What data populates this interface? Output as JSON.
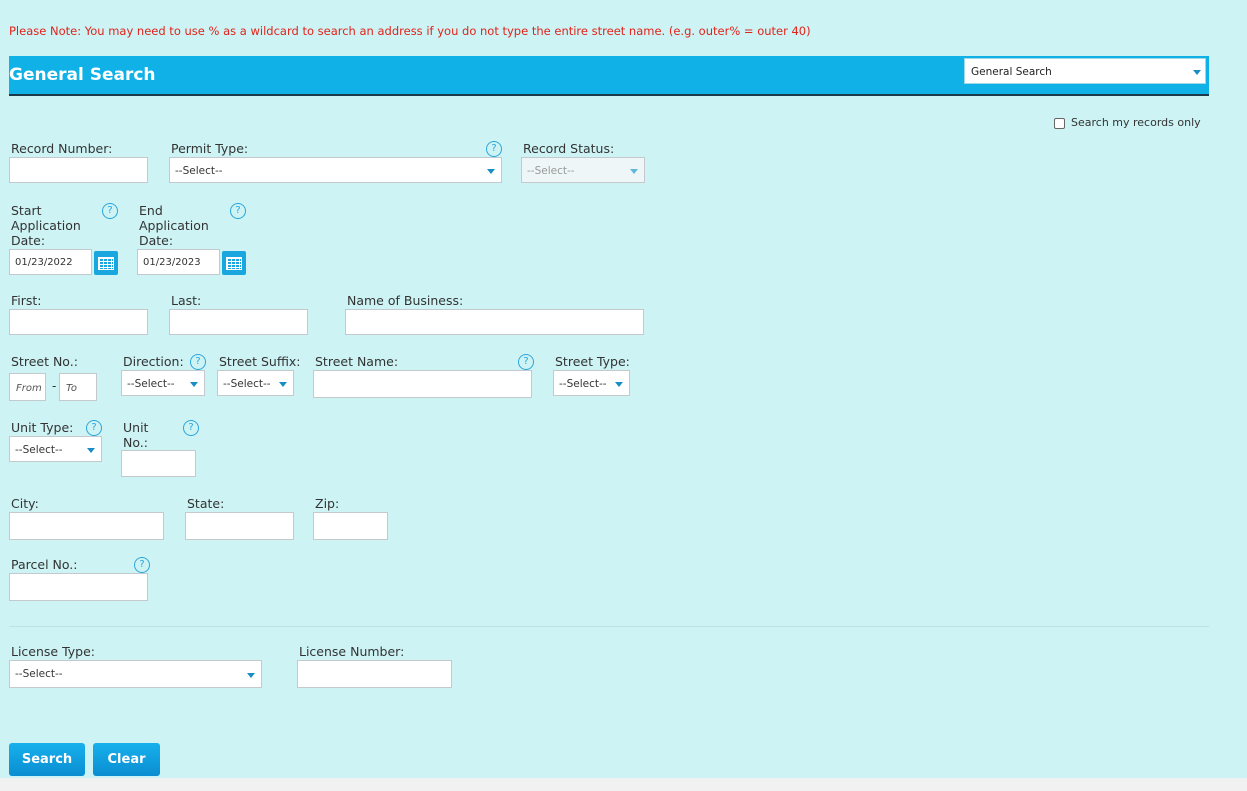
{
  "note": "Please Note: You may need to use % as a wildcard to search an address if you do not type the entire street name. (e.g. outer% = outer 40)",
  "header": {
    "title": "General Search",
    "search_type": "General Search"
  },
  "my_records": {
    "label": "Search my records only",
    "checked": false
  },
  "fields": {
    "record_number": "Record Number:",
    "permit_type": "Permit Type:",
    "record_status": "Record Status:",
    "start_date_line1": "Start",
    "start_date_line2": "Application",
    "start_date_line3": "Date:",
    "end_date_line1": "End",
    "end_date_line2": "Application",
    "end_date_line3": "Date:",
    "first": "First:",
    "last": "Last:",
    "business": "Name of Business:",
    "street_no": "Street No.:",
    "direction": "Direction:",
    "street_suffix": "Street Suffix:",
    "street_name": "Street Name:",
    "street_type": "Street Type:",
    "unit_type": "Unit Type:",
    "unit_no_line1": "Unit",
    "unit_no_line2": "No.:",
    "city": "City:",
    "state": "State:",
    "zip": "Zip:",
    "parcel": "Parcel No.:",
    "license_type": "License Type:",
    "license_number": "License Number:"
  },
  "values": {
    "select": "--Select--",
    "start_date": "01/23/2022",
    "end_date": "01/23/2023",
    "from": "From",
    "to": "To",
    "dash": "-",
    "help": "?"
  },
  "buttons": {
    "search": "Search",
    "clear": "Clear"
  },
  "colors": {
    "background": "#cdf3f4",
    "header": "#0fb1e6",
    "note": "#e2231a",
    "button": "#0fa0e0"
  }
}
